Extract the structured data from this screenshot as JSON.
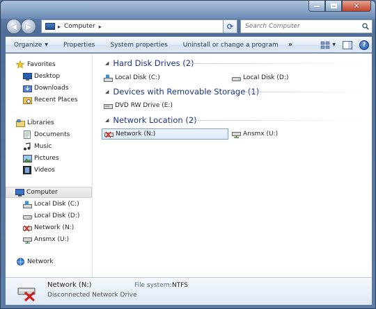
{
  "window": {
    "caption_buttons": [
      "minimize-icon",
      "maximize-icon",
      "close-icon"
    ]
  },
  "nav": {
    "address": {
      "icon": "computer-icon",
      "separator": "▸",
      "path": "Computer",
      "trailing_separator": "▸"
    },
    "search_placeholder": "Search Computer"
  },
  "toolbar": {
    "organize": "Organize",
    "properties": "Properties",
    "system_properties": "System properties",
    "uninstall": "Uninstall or change a program",
    "more": "»"
  },
  "sidebar": {
    "favorites": {
      "header": "Favorites",
      "items": [
        "Desktop",
        "Downloads",
        "Recent Places"
      ]
    },
    "libraries": {
      "header": "Libraries",
      "items": [
        "Documents",
        "Music",
        "Pictures",
        "Videos"
      ]
    },
    "computer": {
      "header": "Computer",
      "items": [
        "Local Disk (C:)",
        "Local Disk (D:)",
        "Network (N:)",
        "Ansmx (U:)"
      ]
    },
    "network": {
      "header": "Network"
    }
  },
  "main": {
    "groups": [
      {
        "header": "Hard Disk Drives (2)",
        "items": [
          "Local Disk (C:)",
          "Local Disk (D:)"
        ]
      },
      {
        "header": "Devices with Removable Storage (1)",
        "items": [
          "DVD RW Drive (E:)"
        ]
      },
      {
        "header": "Network Location (2)",
        "items": [
          "Network (N:)",
          "Ansmx (U:)"
        ]
      }
    ]
  },
  "details": {
    "name": "Network (N:)",
    "description": "Disconnected Network Drive",
    "fs_label": "File system:",
    "fs_value": "NTFS"
  },
  "colors": {
    "group_header": "#1e3287",
    "selection_border": "#7da2ce",
    "toolbar_text": "#1e395b"
  }
}
